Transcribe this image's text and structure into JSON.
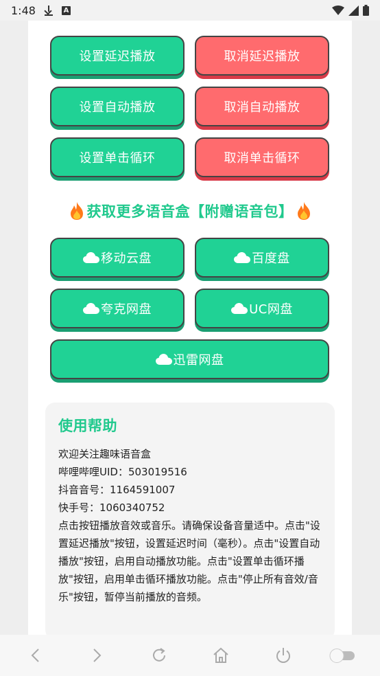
{
  "status_bar": {
    "time": "1:48",
    "notif_icons": [
      "download-icon",
      "a-app-icon"
    ],
    "right_icons": [
      "wifi-icon",
      "signal-icon",
      "battery-icon"
    ]
  },
  "playback_buttons": [
    {
      "label": "设置延迟播放",
      "variant": "green"
    },
    {
      "label": "取消延迟播放",
      "variant": "red"
    },
    {
      "label": "设置自动播放",
      "variant": "green"
    },
    {
      "label": "取消自动播放",
      "variant": "red"
    },
    {
      "label": "设置单击循环",
      "variant": "green"
    },
    {
      "label": "取消单击循环",
      "variant": "red"
    }
  ],
  "more_section": {
    "title": "获取更多语音盒【附赠语音包】",
    "icon": "fire-icon"
  },
  "disk_buttons": [
    {
      "label": "移动云盘",
      "icon": "cloud-icon"
    },
    {
      "label": "百度盘",
      "icon": "cloud-icon"
    },
    {
      "label": "夸克网盘",
      "icon": "cloud-icon"
    },
    {
      "label": "UC网盘",
      "icon": "cloud-icon"
    },
    {
      "label": "迅雷网盘",
      "icon": "cloud-icon"
    }
  ],
  "help": {
    "title": "使用帮助",
    "lines": [
      "欢迎关注趣味语音盒",
      "哔哩哔哩UID：503019516",
      "抖音音号：1164591007",
      "快手号：1060340752",
      "点击按钮播放音效或音乐。请确保设备音量适中。点击\"设置延迟播放\"按钮，设置延迟时间（毫秒）。点击\"设置自动播放\"按钮，启用自动播放功能。点击\"设置单击循环播放\"按钮，启用单击循环播放功能。点击\"停止所有音效/音乐\"按钮，暂停当前播放的音频。"
    ]
  },
  "bottom_nav": [
    "back-icon",
    "forward-icon",
    "refresh-icon",
    "home-icon",
    "power-icon",
    "toggle-switch"
  ],
  "colors": {
    "green": "#20d295",
    "red": "#ff6b6e",
    "accent_text": "#20c98d"
  }
}
